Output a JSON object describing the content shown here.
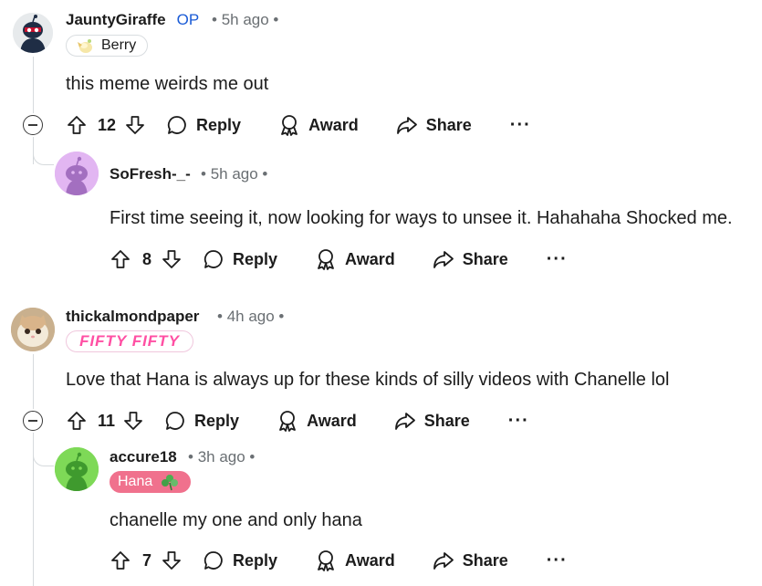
{
  "comments": [
    {
      "username": "JauntyGiraffe",
      "op_label": "OP",
      "time": "5h ago",
      "flair_text": "Berry",
      "flair_icon": "berry-icon",
      "body": "this meme weirds me out",
      "votes": "12",
      "reply": "Reply",
      "award": "Award",
      "share": "Share"
    },
    {
      "username": "SoFresh-_-",
      "time": "5h ago",
      "body": "First time seeing it, now looking for ways to unsee it. Hahahaha Shocked me.",
      "votes": "8",
      "reply": "Reply",
      "award": "Award",
      "share": "Share"
    },
    {
      "username": "thickalmondpaper",
      "time": "4h ago",
      "flair_text": "FIFTY FIFTY",
      "body": "Love that Hana is always up for these kinds of silly videos with Chanelle lol",
      "votes": "11",
      "reply": "Reply",
      "award": "Award",
      "share": "Share"
    },
    {
      "username": "accure18",
      "time": "3h ago",
      "flair_text": "Hana",
      "flair_icon": "clover-icon",
      "body": "chanelle my one and only hana",
      "votes": "7",
      "reply": "Reply",
      "award": "Award",
      "share": "Share"
    }
  ],
  "colors": {
    "op_blue": "#1a5bd6",
    "meta_gray": "#6a6f73",
    "fifty_pink": "#ff4fa3",
    "hana_flair_bg": "#f0718d",
    "thread_line": "#d6dadd"
  }
}
